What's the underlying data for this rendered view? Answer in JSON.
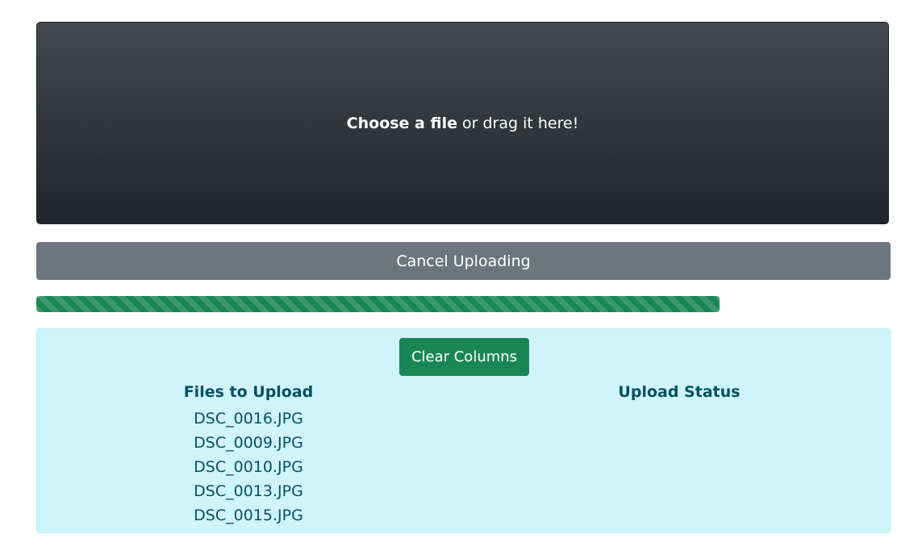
{
  "dropzone": {
    "choose_label": "Choose a file",
    "drag_label": " or drag it here!"
  },
  "cancel_button": {
    "label": "Cancel Uploading"
  },
  "progress": {
    "percent": 80,
    "color": "#198754"
  },
  "panel": {
    "clear_label": "Clear Columns",
    "files_header": "Files to Upload",
    "status_header": "Upload Status",
    "files": [
      "DSC_0016.JPG",
      "DSC_0009.JPG",
      "DSC_0010.JPG",
      "DSC_0013.JPG",
      "DSC_0015.JPG"
    ]
  },
  "colors": {
    "cancel": "#6c757d",
    "success": "#198754",
    "info_bg": "#cff4fc",
    "info_text": "#055160"
  }
}
